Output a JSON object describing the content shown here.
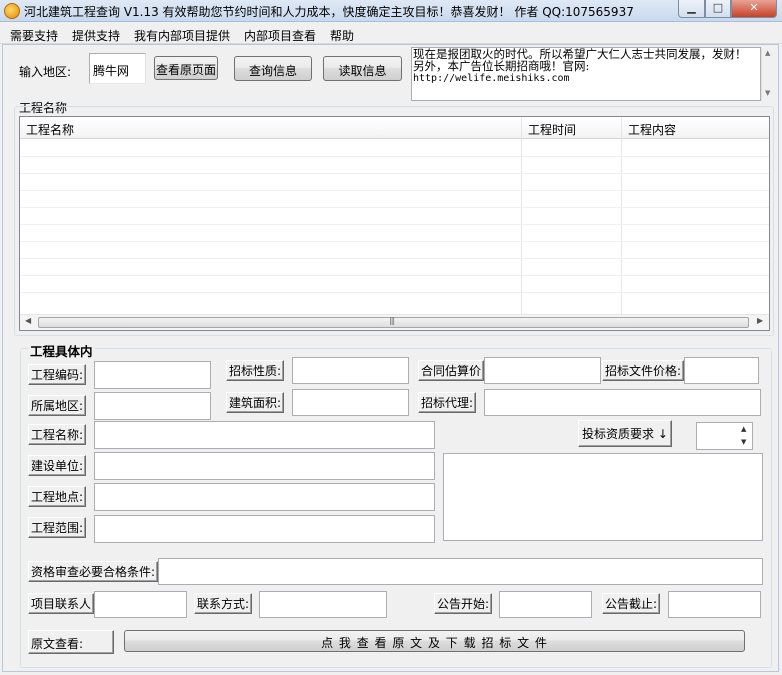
{
  "window": {
    "title": "河北建筑工程查询 V1.13  有效帮助您节约时间和人力成本，快度确定主攻目标！恭喜发财！ 作者 QQ:107565937",
    "min_label": "▁",
    "max_label": "□",
    "close_label": "✕"
  },
  "menu": {
    "items": [
      "需要支持",
      "提供支持",
      "我有内部项目提供",
      "内部项目查看",
      "帮助"
    ]
  },
  "search": {
    "region_label": "输入地区:",
    "region_value": "腾牛网",
    "view_original_button": "查看原页面",
    "query_button": "查询信息",
    "read_button": "读取信息"
  },
  "ad": {
    "text": "现在是报团取火的时代。所以希望广大仁人志士共同发展，发财！另外，本广告位长期招商哦！官网:",
    "url": "http://welife.meishiks.com"
  },
  "project_list": {
    "group_label": "工程名称",
    "columns": [
      "工程名称",
      "工程时间",
      "工程内容"
    ],
    "rows": []
  },
  "details": {
    "group_title": "工程具体内",
    "project_code_label": "工程编码:",
    "bid_type_label": "招标性质:",
    "contract_estimate_label": "合同估算价",
    "doc_price_label": "招标文件价格:",
    "region_label": "所属地区:",
    "building_area_label": "建筑面积:",
    "bid_agent_label": "招标代理:",
    "project_name_label": "工程名称:",
    "qualification_button": "投标资质要求 ↓",
    "builder_label": "建设单位:",
    "location_label": "工程地点:",
    "scope_label": "工程范围:",
    "qualification_conditions_label": "资格审查必要合格条件:",
    "contact_label": "项目联系人",
    "contact_method_label": "联系方式:",
    "notice_start_label": "公告开始:",
    "notice_end_label": "公告截止:",
    "original_view_label": "原文查看:",
    "download_button": "点 我 查 看 原 文 及 下 载 招 标 文 件"
  }
}
